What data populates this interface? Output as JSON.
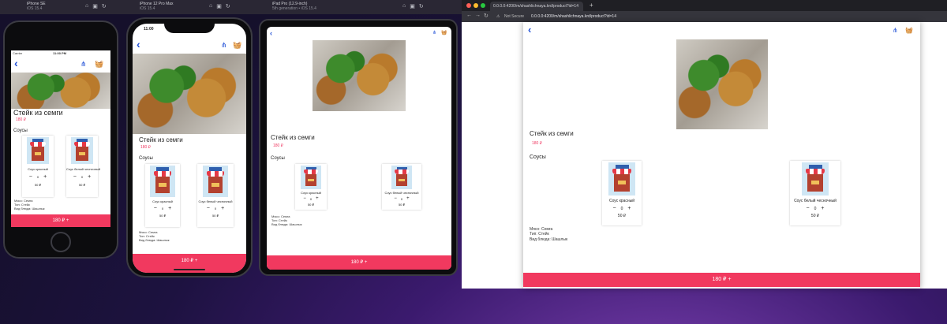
{
  "simulators": [
    {
      "title": "iPhone SE",
      "sub": "iOS 15.4"
    },
    {
      "title": "iPhone 12 Pro Max",
      "sub": "iOS 15.4"
    },
    {
      "title": "iPad Pro (12.9-inch)",
      "sub": "5th generation • iOS 15.4"
    }
  ],
  "status": {
    "carrier": "Carrier",
    "time_se": "11:00 PM",
    "time_12": "11:00"
  },
  "product": {
    "title": "Стейк из семги",
    "price": "180 ₽",
    "sauces_heading": "Соусы",
    "sauces": [
      {
        "name": "Соус красный",
        "qty": "0",
        "minus": "−",
        "plus": "+",
        "price": "50 ₽"
      },
      {
        "name": "Соус белый чесночный",
        "qty": "0",
        "minus": "−",
        "plus": "+",
        "price": "50 ₽"
      }
    ],
    "meta": [
      "Мясо: Семга",
      "Тип: Стейк",
      "Вид блюда: Шашлык"
    ],
    "cta_label": "180 ₽",
    "cta_plus": "+"
  },
  "icons": {
    "back": "‹",
    "share": "⋔",
    "cart": "🧺"
  },
  "browser": {
    "tab_title": "0.0.0.0:4200/m/shashlichnaya.krd/product?id=14",
    "new_tab": "+",
    "not_secure": "Not Secure",
    "url": "0.0.0.0:4200/m/shashlichnaya.krd/product?id=14"
  },
  "colors": {
    "accent": "#f1395f",
    "link": "#1f4fd6"
  }
}
